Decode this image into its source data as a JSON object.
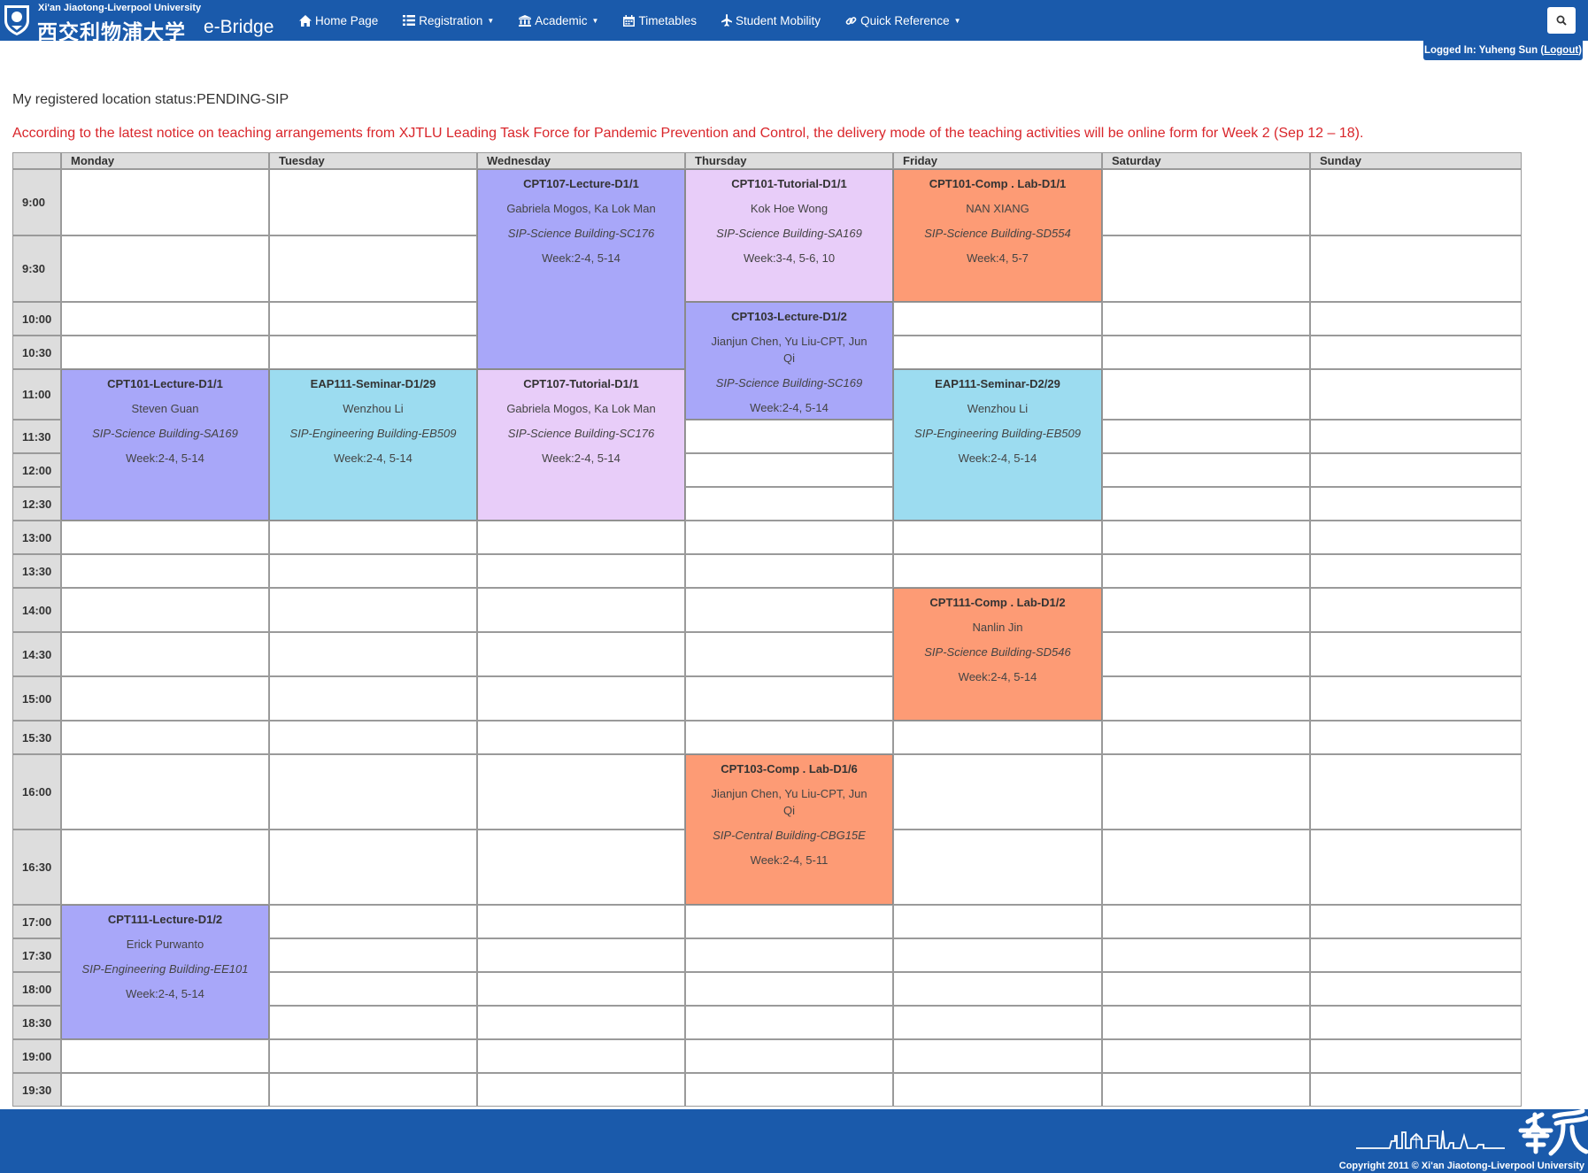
{
  "brand": {
    "university_en": "Xi'an Jiaotong-Liverpool University",
    "university_cn": "西交利物浦大学",
    "app_name": "e-Bridge"
  },
  "nav": {
    "items": [
      {
        "label": "Home Page",
        "icon": "home-icon",
        "dropdown": false
      },
      {
        "label": "Registration",
        "icon": "list-icon",
        "dropdown": true
      },
      {
        "label": "Academic",
        "icon": "institution-icon",
        "dropdown": true
      },
      {
        "label": "Timetables",
        "icon": "calendar-icon",
        "dropdown": false
      },
      {
        "label": "Student Mobility",
        "icon": "plane-icon",
        "dropdown": false
      },
      {
        "label": "Quick Reference",
        "icon": "link-icon",
        "dropdown": true
      }
    ]
  },
  "login": {
    "prefix": "Logged In: Yuheng Sun (",
    "logout": "Logout",
    "suffix": ")"
  },
  "status": {
    "text": "My registered location status:PENDING-SIP"
  },
  "notice": {
    "text": "According to the latest notice on teaching arrangements from XJTLU Leading Task Force for Pandemic Prevention and Control, the delivery mode of the teaching activities will be online form for Week 2 (Sep 12 – 18)."
  },
  "timetable": {
    "days": [
      "Monday",
      "Tuesday",
      "Wednesday",
      "Thursday",
      "Friday",
      "Saturday",
      "Sunday"
    ],
    "times": [
      "9:00",
      "9:30",
      "10:00",
      "10:30",
      "11:00",
      "11:30",
      "12:00",
      "12:30",
      "13:00",
      "13:30",
      "14:00",
      "14:30",
      "15:00",
      "15:30",
      "16:00",
      "16:30",
      "17:00",
      "17:30",
      "18:00",
      "18:30",
      "19:00",
      "19:30"
    ],
    "events": [
      {
        "title": "CPT107-Lecture-D1/1",
        "staff": "Gabriela Mogos, Ka Lok Man",
        "location": "SIP-Science Building-SC176",
        "weeks": "Week:2-4, 5-14",
        "day": 2,
        "start": 0,
        "span": 4,
        "kind": "lecture"
      },
      {
        "title": "CPT101-Tutorial-D1/1",
        "staff": "Kok Hoe Wong",
        "location": "SIP-Science Building-SA169",
        "weeks": "Week:3-4, 5-6, 10",
        "day": 3,
        "start": 0,
        "span": 2,
        "kind": "tutorial"
      },
      {
        "title": "CPT101-Comp . Lab-D1/1",
        "staff": "NAN XIANG",
        "location": "SIP-Science Building-SD554",
        "weeks": "Week:4, 5-7",
        "day": 4,
        "start": 0,
        "span": 2,
        "kind": "lab"
      },
      {
        "title": "CPT103-Lecture-D1/2",
        "staff": "Jianjun Chen, Yu Liu-CPT, Jun Qi",
        "location": "SIP-Science Building-SC169",
        "weeks": "Week:2-4, 5-14",
        "day": 3,
        "start": 2,
        "span": 3,
        "kind": "lecture"
      },
      {
        "title": "CPT101-Lecture-D1/1",
        "staff": "Steven Guan",
        "location": "SIP-Science Building-SA169",
        "weeks": "Week:2-4, 5-14",
        "day": 0,
        "start": 4,
        "span": 4,
        "kind": "lecture"
      },
      {
        "title": "EAP111-Seminar-D1/29",
        "staff": "Wenzhou Li",
        "location": "SIP-Engineering Building-EB509",
        "weeks": "Week:2-4, 5-14",
        "day": 1,
        "start": 4,
        "span": 4,
        "kind": "seminar"
      },
      {
        "title": "CPT107-Tutorial-D1/1",
        "staff": "Gabriela Mogos, Ka Lok Man",
        "location": "SIP-Science Building-SC176",
        "weeks": "Week:2-4, 5-14",
        "day": 2,
        "start": 4,
        "span": 4,
        "kind": "tutorial"
      },
      {
        "title": "EAP111-Seminar-D2/29",
        "staff": "Wenzhou Li",
        "location": "SIP-Engineering Building-EB509",
        "weeks": "Week:2-4, 5-14",
        "day": 4,
        "start": 4,
        "span": 4,
        "kind": "seminar"
      },
      {
        "title": "CPT111-Comp . Lab-D1/2",
        "staff": "Nanlin Jin",
        "location": "SIP-Science Building-SD546",
        "weeks": "Week:2-4, 5-14",
        "day": 4,
        "start": 10,
        "span": 3,
        "kind": "lab"
      },
      {
        "title": "CPT103-Comp . Lab-D1/6",
        "staff": "Jianjun Chen, Yu Liu-CPT, Jun Qi",
        "location": "SIP-Central Building-CBG15E",
        "weeks": "Week:2-4, 5-11",
        "day": 3,
        "start": 14,
        "span": 2,
        "kind": "lab"
      },
      {
        "title": "CPT111-Lecture-D1/2",
        "staff": "Erick Purwanto",
        "location": "SIP-Engineering Building-EE101",
        "weeks": "Week:2-4, 5-14",
        "day": 0,
        "start": 16,
        "span": 4,
        "kind": "lecture"
      }
    ]
  },
  "colors": {
    "brand": "#1a5aab",
    "notice": "#d9262b",
    "lecture": "#a8a7f9",
    "tutorial": "#e8cdf9",
    "lab": "#fd9b75",
    "seminar": "#9cdcf0",
    "header": "#dddddd"
  },
  "footer": {
    "copyright": "Copyright 2011 © Xi'an Jiaotong-Liverpool University"
  }
}
